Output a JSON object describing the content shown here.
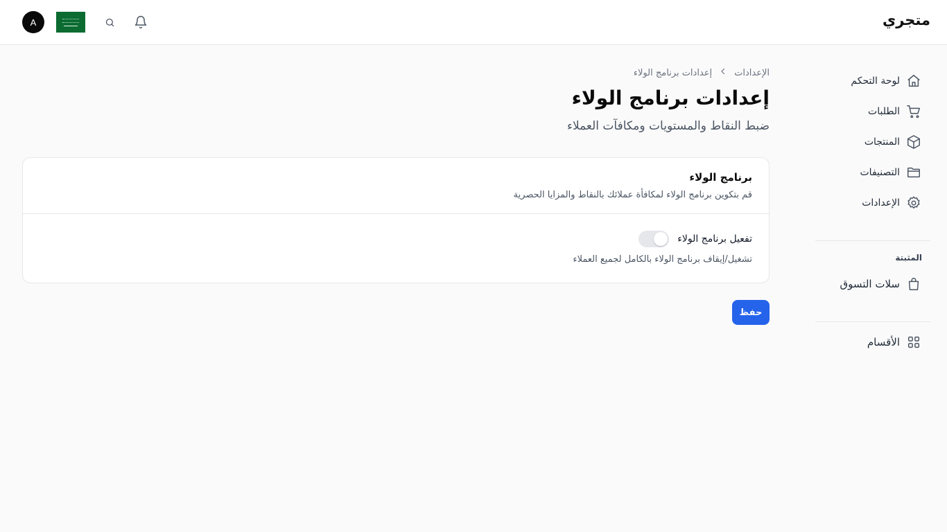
{
  "app": {
    "brand": "متجري",
    "user_initial": "A"
  },
  "icons": {
    "bell": "bell-icon",
    "search": "search-icon",
    "flag": "saudi-flag-icon"
  },
  "sidebar": {
    "items": [
      {
        "label": "لوحة التحكم",
        "icon": "home-icon"
      },
      {
        "label": "الطلبات",
        "icon": "cart-icon"
      },
      {
        "label": "المنتجات",
        "icon": "box-icon"
      },
      {
        "label": "التصنيفات",
        "icon": "folder-icon"
      },
      {
        "label": "الإعدادات",
        "icon": "gear-icon"
      }
    ],
    "pinned_title": "المثبتة",
    "pinned": [
      {
        "label": "سلات التسوق",
        "icon": "shopping-bag-icon"
      }
    ],
    "sections": {
      "label": "الأقسام",
      "icon": "grid-icon"
    }
  },
  "breadcrumb": {
    "root": "الإعدادات",
    "current": "إعدادات برنامج الولاء"
  },
  "page": {
    "title": "إعدادات برنامج الولاء",
    "subtitle": "ضبط النقاط والمستويات ومكافآت العملاء"
  },
  "card": {
    "title": "برنامج الولاء",
    "description": "قم بتكوين برنامج الولاء لمكافأة عملائك بالنقاط والمزايا الحصرية",
    "toggle_label": "تفعيل برنامج الولاء",
    "toggle_description": "تشغيل/إيقاف برنامج الولاء بالكامل لجميع العملاء",
    "toggle_on": false
  },
  "actions": {
    "save_label": "حفظ"
  },
  "colors": {
    "primary": "#2563eb",
    "flag_green": "#0b6b31",
    "toggle_off": "#e5e7eb"
  }
}
